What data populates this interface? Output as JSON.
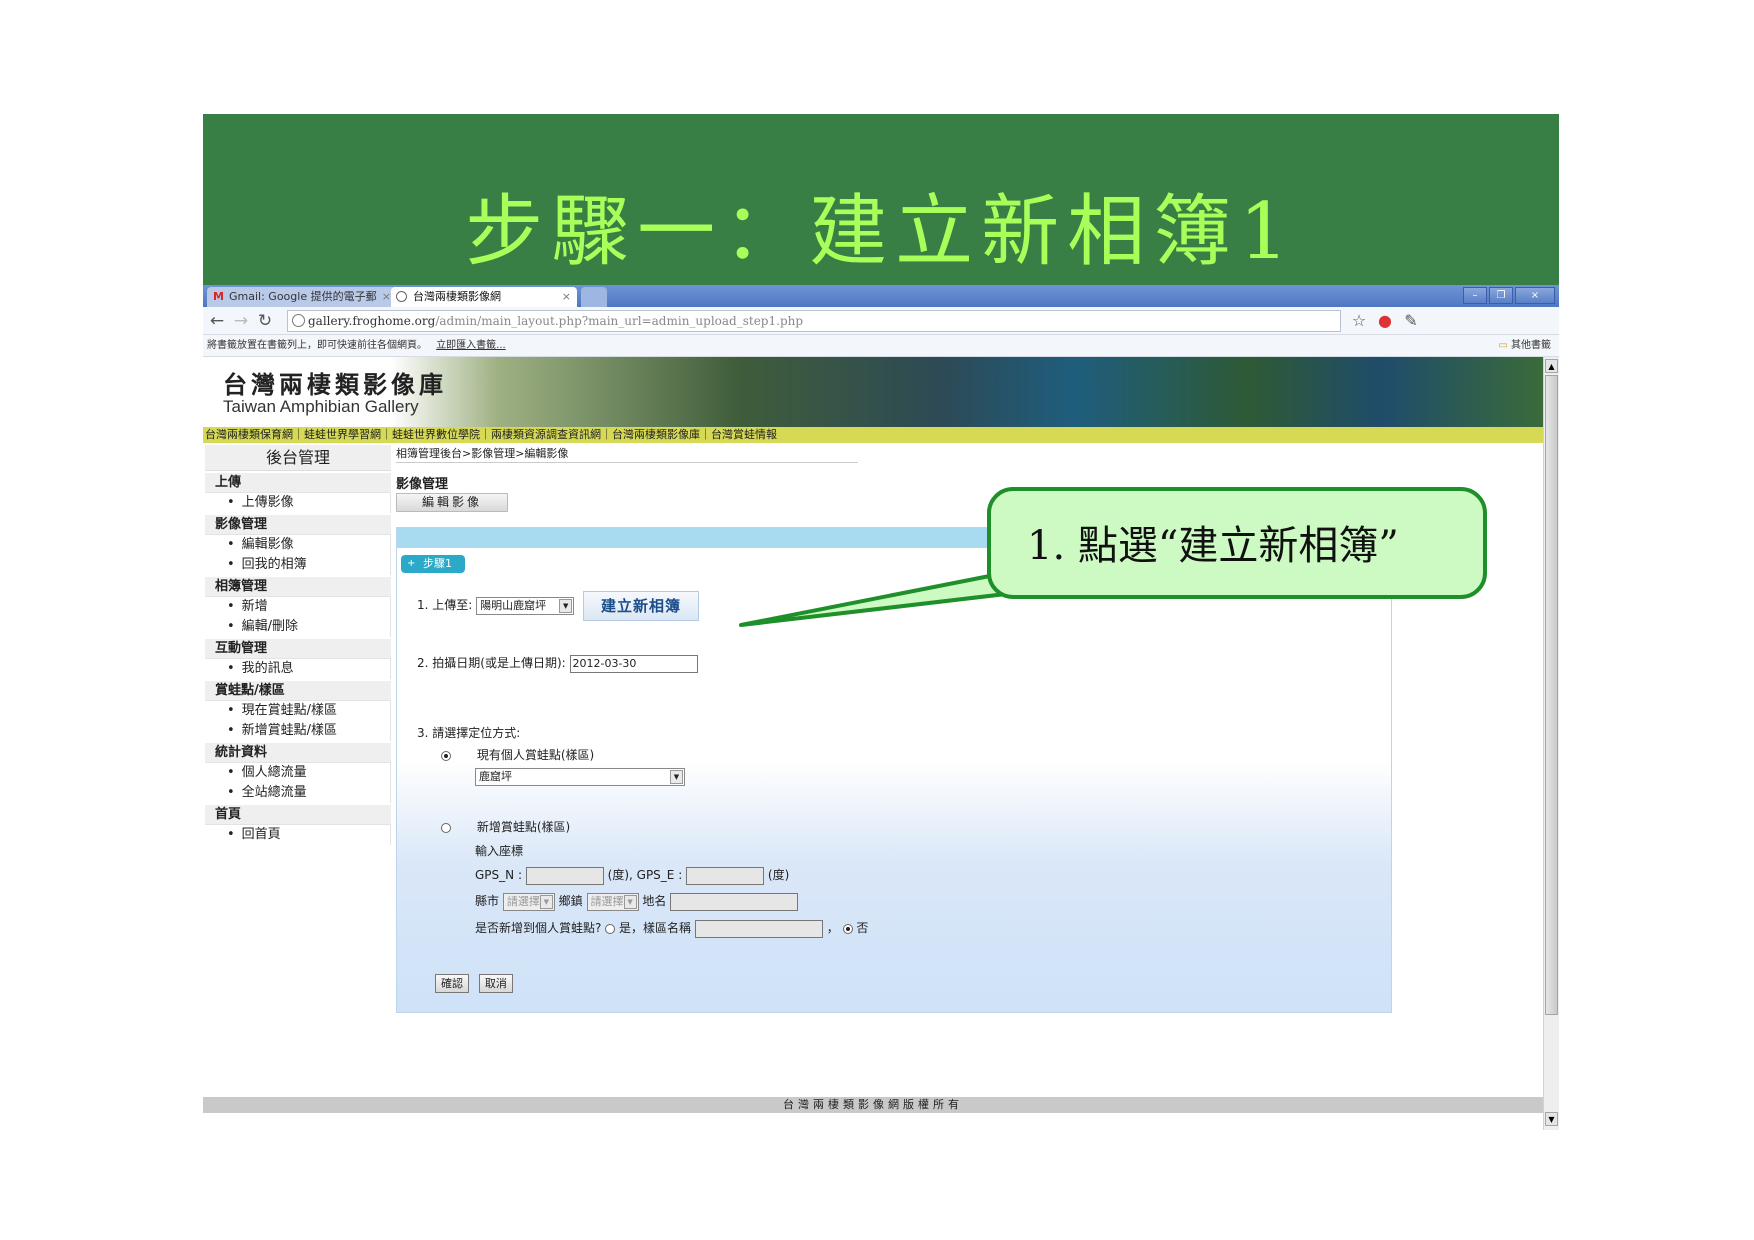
{
  "slide": {
    "title": "步驟一：建立新相簿1"
  },
  "browser": {
    "tabs": [
      {
        "label": "Gmail: Google 提供的電子郵",
        "icon": "gmail-icon"
      },
      {
        "label": "台灣兩棲類影像網",
        "icon": "globe-icon"
      }
    ],
    "address": {
      "host": "gallery.froghome.org",
      "path": "/admin/main_layout.php?main_url=admin_upload_step1.php"
    },
    "bookmark_bar": {
      "hint": "將書籤放置在書籤列上，即可快速前往各個網頁。",
      "import_link": "立即匯入書籤...",
      "other": "其他書籤"
    }
  },
  "site": {
    "title": "台灣兩棲類影像庫",
    "subtitle": "Taiwan Amphibian Gallery",
    "nav": "台灣兩棲類保育網｜蛙蛙世界學習網｜蛙蛙世界數位學院｜兩棲類資源調查資訊網｜台灣兩棲類影像庫｜台灣賞蛙情報",
    "footer": "台灣兩棲類影像網版權所有"
  },
  "sidebar": {
    "title": "後台管理",
    "sections": [
      {
        "label": "上傳",
        "items": [
          "上傳影像"
        ]
      },
      {
        "label": "影像管理",
        "items": [
          "編輯影像",
          "回我的相簿"
        ]
      },
      {
        "label": "相簿管理",
        "items": [
          "新增",
          "編輯/刪除"
        ]
      },
      {
        "label": "互動管理",
        "items": [
          "我的訊息"
        ]
      },
      {
        "label": "賞蛙點/樣區",
        "items": [
          "現在賞蛙點/樣區",
          "新增賞蛙點/樣區"
        ]
      },
      {
        "label": "統計資料",
        "items": [
          "個人總流量",
          "全站總流量"
        ]
      },
      {
        "label": "首頁",
        "items": [
          "回首頁"
        ]
      }
    ]
  },
  "main": {
    "breadcrumb": "相簿管理後台>影像管理>編輯影像",
    "section_title": "影像管理",
    "edit_button": "編輯影像",
    "step_tab": "步驟1",
    "field1": {
      "label": "1. 上傳至:",
      "selected": "陽明山鹿窟坪",
      "create_button": "建立新相簿"
    },
    "field2": {
      "label": "2. 拍攝日期(或是上傳日期):",
      "value": "2012-03-30"
    },
    "field3": {
      "label": "3. 請選擇定位方式:",
      "option_existing": "現有個人賞蛙點(樣區)",
      "existing_selected": "鹿窟坪",
      "option_new": "新增賞蛙點(樣區)",
      "coords_label": "輸入座標",
      "gps_n": "GPS_N :",
      "gps_n_unit": "(度), GPS_E :",
      "gps_e_unit": "(度)",
      "county": "縣市",
      "county_placeholder": "請選擇",
      "town": "鄉鎮",
      "town_placeholder": "請選擇",
      "place": "地名",
      "add_personal": "是否新增到個人賞蛙點?",
      "yes": "是，樣區名稱",
      "sep": "，",
      "no": "否"
    },
    "confirm": "確認",
    "cancel": "取消"
  },
  "callout": {
    "text": "1. 點選“建立新相簿”"
  },
  "colors": {
    "banner": "#377f45",
    "banner_title": "#a8ff5a",
    "callout_fill": "#cdf9c3",
    "callout_border": "#1f8f2a"
  }
}
